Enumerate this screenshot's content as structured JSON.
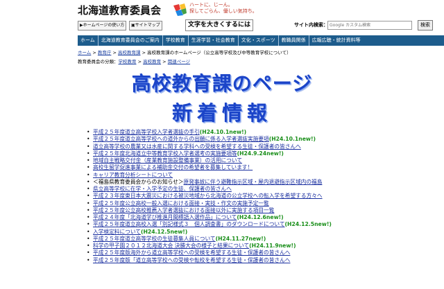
{
  "header": {
    "title": "北海道教育委員会",
    "slogan_line1": "ハートに、じーん。",
    "slogan_line2": "探してごらん、優しい気持ち。"
  },
  "toolbar": {
    "home_usage": "ホームページの使い方",
    "sitemap": "サイトマップ",
    "enlarge_text": "文字を大きくするには",
    "search_label": "サイト内検索：",
    "search_placeholder": "Google カスタム検索",
    "search_button": "検索"
  },
  "nav": [
    "ホーム",
    "北海道教育委員会のご案内",
    "学校教育",
    "生涯学習・社会教育",
    "文化・スポーツ",
    "教職員関係",
    "広報広聴・統計資料等"
  ],
  "breadcrumb": {
    "items": [
      "ホーム",
      "教育庁",
      "高校教育課"
    ],
    "sep": " > ",
    "current": "高校教育課のホームページ（公立高等学校及び中等教育学校について）"
  },
  "classification": {
    "label": "教育委員会の分類：",
    "items": [
      "学校教育",
      "高校教育",
      "関連ページ"
    ],
    "sep": " > "
  },
  "banner": {
    "line1": "高校教育課のページ",
    "line2": "新着情報"
  },
  "news": [
    {
      "text": "平成２５年度道立高等学校入学者選抜の手引",
      "new": "(H24.10.1new!)",
      "tail": ""
    },
    {
      "text": "平成２５年度道立高等学校への道外からの出願に係る入学者選抜実施要項",
      "new": "(H24.10.1new!)",
      "tail": ""
    },
    {
      "text": "道立高等学校の農業又は水産に関する学科への受検を希望する生徒・保護者の皆さんへ",
      "new": "",
      "tail": ""
    },
    {
      "text": "平成２５年度北海道立中等教育学校入学者選考の実施要項等",
      "new": "(H24.9.24new!)",
      "tail": ""
    },
    {
      "text": "地域自主戦略交付金（産業教育施設整備事業）の活用について",
      "new": "",
      "tail": ""
    },
    {
      "text": "高校生留学促進事業による補助金交付の希望者を募集しています！",
      "new": "",
      "tail": ""
    },
    {
      "text": "キャリア教育分析シートについて",
      "new": "",
      "tail": ""
    },
    {
      "text": "＜福島県教育委員会からのお知らせ＞",
      "new": "",
      "tail": "原発事故に伴う避難指示区域・屋内退避指示区域内の福島"
    },
    {
      "text": "県立高等学校に在学・入学予定の生徒、保護者の皆さんへ",
      "new": "",
      "tail": ""
    },
    {
      "text": "平成２３年度東日本大震災における被災地域から北海道の公立学校への転入学を希望する方々へ",
      "new": "",
      "tail": ""
    },
    {
      "text": "平成２５年度公立高校一般入選における面接・実技・作文の実施予定一覧",
      "new": "",
      "tail": ""
    },
    {
      "text": "平成２５年度公立高校推薦入学者選抜における面接以外に実施する項目一覧",
      "new": "",
      "tail": ""
    },
    {
      "text": "平成２４年度「北海道学び推進月間標語入選作品」について",
      "new": "(H24.12.6new!)",
      "tail": ""
    },
    {
      "text": "平成２５年度道立高校入選「別記様式３　個人調査書」のダウンロードについて",
      "new": "(H24.12.5new!)",
      "tail": ""
    },
    {
      "text": "入学検定料について",
      "new": "(H24.12.5new!)",
      "tail": ""
    },
    {
      "text": "平成２５年度道立高等学校の生徒募集人員について",
      "new": "(H24.11.27new!)",
      "tail": ""
    },
    {
      "text": "科学の甲子園２０１２北海道大会 決勝大会の様子と結果について",
      "new": "(H24.11.9new!)",
      "tail": ""
    },
    {
      "text": "平成２５年度版海外から道立高等学校への受検を希望する生徒・保護者の皆さんへ",
      "new": "",
      "tail": ""
    },
    {
      "text": "平成２５年度版「道立高等学校への受検や転校を希望する生徒・保護者の皆さんへ",
      "new": "",
      "tail": ""
    }
  ],
  "colors": {
    "nav_bg": "#1d5c8c",
    "banner": "#1b44c8",
    "link": "#1a2fa0",
    "new_badge": "#1a8f1a"
  }
}
